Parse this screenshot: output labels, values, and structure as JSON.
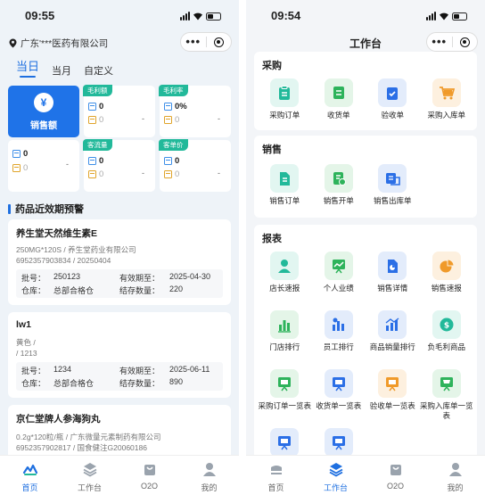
{
  "left": {
    "time": "09:55",
    "location": "广东'***医药有限公司",
    "tabs": [
      "当日",
      "当月",
      "自定义"
    ],
    "sales_label": "销售额",
    "kpi": [
      {
        "badge": "毛利额",
        "v1": "0",
        "v2": "0",
        "dash": "-"
      },
      {
        "badge": "毛利率",
        "v1": "0%",
        "v2": "0",
        "dash": "-"
      },
      {
        "badge": "",
        "v1": "0",
        "v2": "0",
        "dash": "-"
      },
      {
        "badge": "客流量",
        "v1": "0",
        "v2": "0",
        "dash": "-"
      },
      {
        "badge": "客单价",
        "v1": "0",
        "v2": "0",
        "dash": "-"
      }
    ],
    "section_title": "药品近效期预警",
    "products": [
      {
        "name": "养生堂天然维生素E",
        "spec": "250MG*120S / 养生堂药业有限公司",
        "code": "6952357903834 / 20250404",
        "batch_label": "批号：",
        "batch": "250123",
        "exp_label": "有效期至：",
        "exp": "2025-04-30",
        "wh_label": "仓库：",
        "wh": "总部合格仓",
        "qty_label": "结存数量：",
        "qty": "220"
      },
      {
        "name": "lw1",
        "spec": "黄色 /",
        "code": "/ 1213",
        "batch_label": "批号：",
        "batch": "1234",
        "exp_label": "有效期至：",
        "exp": "2025-06-11",
        "wh_label": "仓库：",
        "wh": "总部合格仓",
        "qty_label": "结存数量：",
        "qty": "890"
      },
      {
        "name": "京仁堂牌人参海狗丸",
        "spec": "0.2g*120粒/瓶 / 广东微量元素制药有限公司",
        "code": "6952357902817 / 国食健注G20060186"
      }
    ],
    "nav": [
      "首页",
      "工作台",
      "O2O",
      "我的"
    ]
  },
  "right": {
    "time": "09:54",
    "title": "工作台",
    "sections": [
      {
        "title": "采购",
        "items": [
          {
            "label": "采购订单",
            "icon": "clipboard-icon",
            "color": "#22b99a",
            "bg": "#e2f6f1"
          },
          {
            "label": "收货单",
            "icon": "receipt-icon",
            "color": "#2eb35b",
            "bg": "#e4f5e8"
          },
          {
            "label": "验收单",
            "icon": "check-clipboard-icon",
            "color": "#2b6fe6",
            "bg": "#e3ecfb"
          },
          {
            "label": "采购入库单",
            "icon": "cart-icon",
            "color": "#f09a2a",
            "bg": "#fdf0df"
          }
        ]
      },
      {
        "title": "销售",
        "items": [
          {
            "label": "销售订单",
            "icon": "document-icon",
            "color": "#22b99a",
            "bg": "#e2f6f1"
          },
          {
            "label": "销售开单",
            "icon": "invoice-icon",
            "color": "#2eb35b",
            "bg": "#e4f5e8"
          },
          {
            "label": "销售出库单",
            "icon": "outbound-icon",
            "color": "#2b6fe6",
            "bg": "#e3ecfb"
          }
        ]
      },
      {
        "title": "报表",
        "items": [
          {
            "label": "店长速报",
            "icon": "person-icon",
            "color": "#22b99a",
            "bg": "#e2f6f1"
          },
          {
            "label": "个人业绩",
            "icon": "trend-board-icon",
            "color": "#2eb35b",
            "bg": "#e4f5e8"
          },
          {
            "label": "销售详情",
            "icon": "doc-chart-icon",
            "color": "#2b6fe6",
            "bg": "#e3ecfb"
          },
          {
            "label": "销售速报",
            "icon": "pie-chart-icon",
            "color": "#f09a2a",
            "bg": "#fdf0df"
          },
          {
            "label": "门店排行",
            "icon": "bar-chart-icon",
            "color": "#2eb35b",
            "bg": "#e4f5e8"
          },
          {
            "label": "员工排行",
            "icon": "staff-rank-icon",
            "color": "#2b6fe6",
            "bg": "#e3ecfb"
          },
          {
            "label": "商品销量排行",
            "icon": "goods-rank-icon",
            "color": "#2b6fe6",
            "bg": "#e3ecfb"
          },
          {
            "label": "负毛利商品",
            "icon": "negative-profit-icon",
            "color": "#22b99a",
            "bg": "#e2f6f1"
          },
          {
            "label": "采购订单一览表",
            "icon": "board-icon",
            "color": "#2eb35b",
            "bg": "#e4f5e8"
          },
          {
            "label": "收货单一览表",
            "icon": "board-icon",
            "color": "#2b6fe6",
            "bg": "#e3ecfb"
          },
          {
            "label": "验收单一览表",
            "icon": "board-icon",
            "color": "#f09a2a",
            "bg": "#fdf0df"
          },
          {
            "label": "采购入库单一览表",
            "icon": "board-cart-icon",
            "color": "#2eb35b",
            "bg": "#e4f5e8"
          },
          {
            "label": "",
            "icon": "board-icon",
            "color": "#2b6fe6",
            "bg": "#e3ecfb"
          },
          {
            "label": "",
            "icon": "board-icon",
            "color": "#2b6fe6",
            "bg": "#e3ecfb"
          }
        ]
      }
    ],
    "nav": [
      "首页",
      "工作台",
      "O2O",
      "我的"
    ]
  }
}
